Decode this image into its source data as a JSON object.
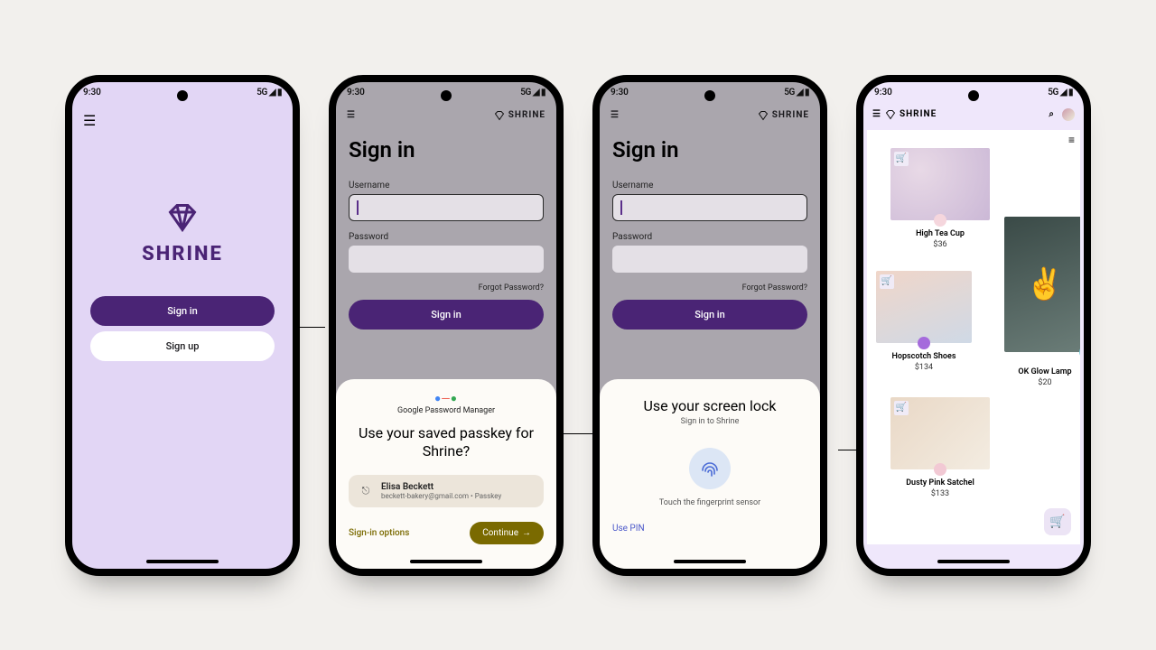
{
  "status": {
    "time": "9:30",
    "network": "5G",
    "signal": "◢◣ ▮"
  },
  "brand": "SHRINE",
  "screen1": {
    "signin": "Sign in",
    "signup": "Sign up"
  },
  "signin_form": {
    "title": "Sign in",
    "username_label": "Username",
    "password_label": "Password",
    "forgot": "Forgot Password?",
    "button": "Sign in"
  },
  "sheet_passkey": {
    "provider": "Google Password Manager",
    "heading": "Use your saved passkey for Shrine?",
    "account_name": "Elisa Beckett",
    "account_sub": "beckett-bakery@gmail.com • Passkey",
    "options": "Sign-in options",
    "continue": "Continue"
  },
  "sheet_lock": {
    "heading": "Use your screen lock",
    "sub": "Sign in to Shrine",
    "touch": "Touch the fingerprint sensor",
    "use_pin": "Use PIN"
  },
  "store": {
    "tune_icon": "☰",
    "products": [
      {
        "name": "High Tea Cup",
        "price": "$36"
      },
      {
        "name": "Hopscotch Shoes",
        "price": "$134"
      },
      {
        "name": "Dusty Pink Satchel",
        "price": "$133"
      },
      {
        "name": "OK Glow Lamp",
        "price": "$20"
      }
    ]
  },
  "colors": {
    "purple": "#5a2e8a",
    "lavender": "#e2d6f5",
    "surface": "#fdfbf7",
    "green": "#7a6a00"
  }
}
